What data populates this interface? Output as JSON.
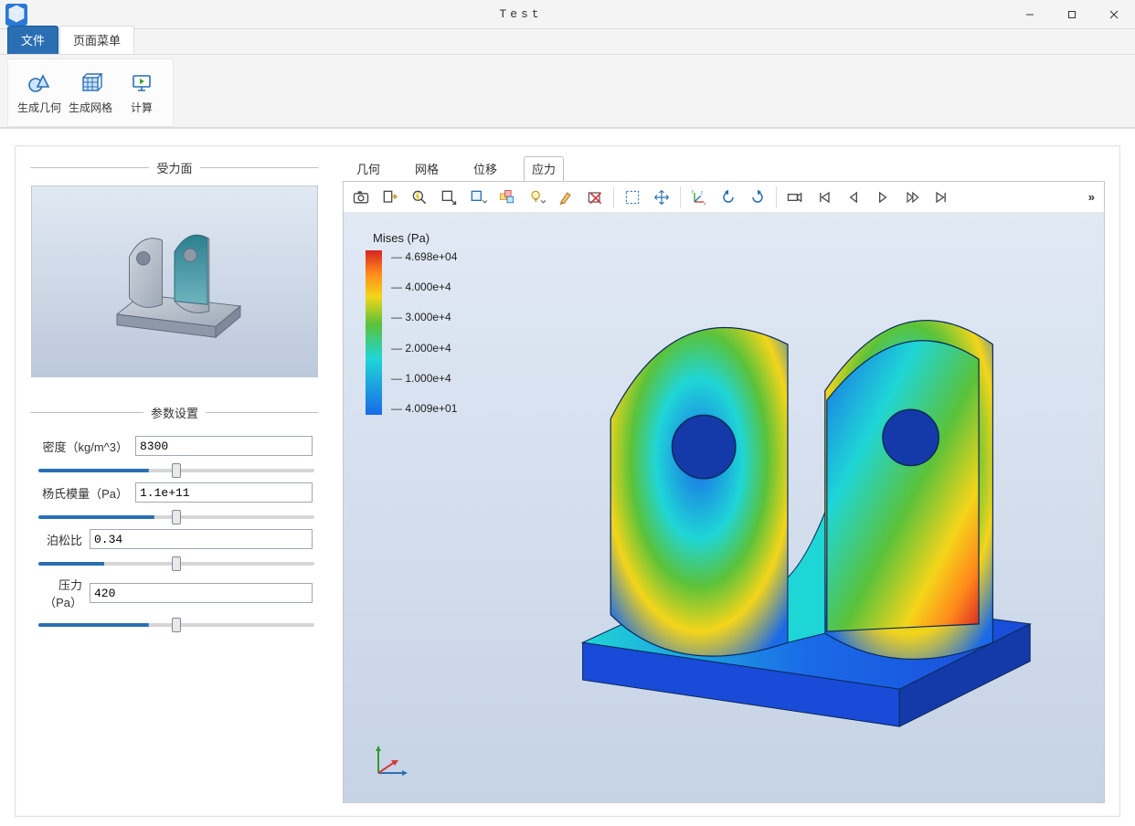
{
  "window": {
    "title": "Test"
  },
  "menu": {
    "tabs": [
      "文件",
      "页面菜单"
    ],
    "active_index": 0
  },
  "ribbon": {
    "items": [
      {
        "label": "生成几何",
        "icon": "gen-geometry-icon"
      },
      {
        "label": "生成网格",
        "icon": "gen-mesh-icon"
      },
      {
        "label": "计算",
        "icon": "compute-icon"
      }
    ]
  },
  "left": {
    "preview_title": "受力面",
    "params_title": "参数设置",
    "density": {
      "label": "密度（kg/m^3）",
      "value": "8300",
      "slider_pct": 40
    },
    "youngs": {
      "label": "杨氏模量（Pa）",
      "value": "1.1e+11",
      "slider_pct": 42
    },
    "poisson": {
      "label": "泊松比",
      "value": "0.34",
      "slider_pct": 24
    },
    "pressure": {
      "label": "压力（Pa）",
      "value": "420",
      "slider_pct": 40
    }
  },
  "viewer": {
    "tabs": [
      "几何",
      "网格",
      "位移",
      "应力"
    ],
    "active_tab_index": 3,
    "toolbar_buttons": [
      "snapshot-icon",
      "export-icon",
      "zoom-lightning-icon",
      "zoom-box-icon",
      "box-dropdown-icon",
      "origin-dropdown-icon",
      "lightbulb-dropdown-icon",
      "brush-icon",
      "clear-x-icon",
      "SEP",
      "select-rect-icon",
      "move-icon",
      "SEP",
      "orient-axes-icon",
      "rotate-ccw-icon",
      "rotate-cw-icon",
      "SEP",
      "camera-icon",
      "first-icon",
      "prev-icon",
      "play-icon",
      "fwd-icon",
      "last-icon"
    ],
    "legend": {
      "title": "Mises (Pa)",
      "ticks": [
        "4.698e+04",
        "4.000e+4",
        "3.000e+4",
        "2.000e+4",
        "1.000e+4",
        "4.009e+01"
      ]
    }
  }
}
